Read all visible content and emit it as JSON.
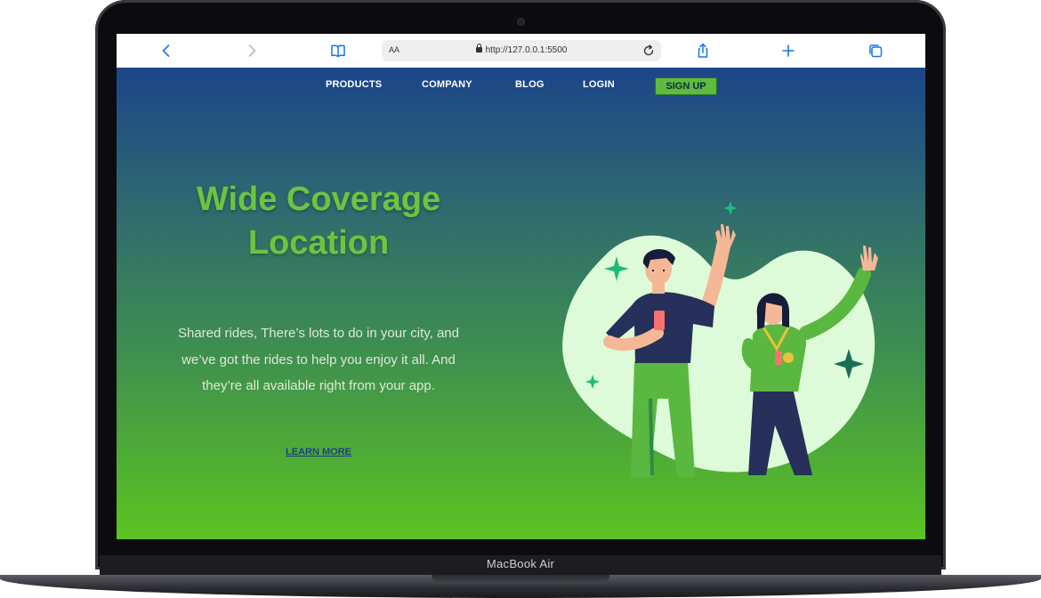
{
  "browser": {
    "reader_label": "AA",
    "url": "http://127.0.0.1:5500"
  },
  "nav": {
    "products": "PRODUCTS",
    "company": "COMPANY",
    "blog": "BLOG",
    "login": "LOGIN",
    "signup": "SIGN UP"
  },
  "hero": {
    "title_line1": "Wide Coverage",
    "title_line2": "Location",
    "description": "Shared rides, There’s lots to do in your city, and we’ve got the rides to help you enjoy it all. And they’re all available right from your app.",
    "cta": "LEARN MORE"
  },
  "device": {
    "model": "MacBook Air"
  },
  "colors": {
    "brand_green": "#6cc53f",
    "signup_bg": "#5dbb3e",
    "gradient_top": "#1c4589",
    "gradient_bottom": "#5cc321",
    "link_blue": "#1d3f8a",
    "toolbar_accent": "#1a73e8"
  },
  "icons": [
    "back-icon",
    "forward-icon",
    "bookmarks-icon",
    "lock-icon",
    "reload-icon",
    "share-icon",
    "new-tab-icon",
    "tabs-icon"
  ]
}
